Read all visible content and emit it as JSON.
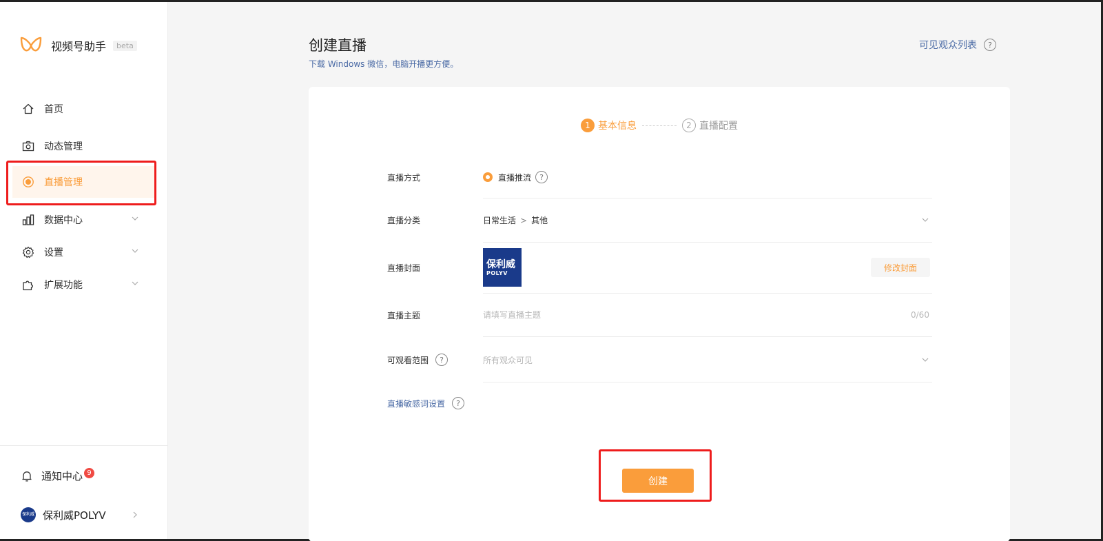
{
  "app": {
    "name": "视频号助手",
    "badge": "beta"
  },
  "sidebar": {
    "items": [
      {
        "label": "首页",
        "icon": "home-icon"
      },
      {
        "label": "动态管理",
        "icon": "camera-icon"
      },
      {
        "label": "直播管理",
        "icon": "live-icon",
        "active": true
      },
      {
        "label": "数据中心",
        "icon": "bar-chart-icon",
        "expandable": true
      },
      {
        "label": "设置",
        "icon": "gear-icon",
        "expandable": true
      },
      {
        "label": "扩展功能",
        "icon": "puzzle-icon",
        "expandable": true
      }
    ],
    "notification": {
      "label": "通知中心",
      "count": "9"
    },
    "account": {
      "name": "保利威POLYV",
      "avatar_text": "保利威"
    }
  },
  "header": {
    "title": "创建直播",
    "subtitle": "下载 Windows 微信，电脑开播更方便。",
    "audience_link": "可见观众列表",
    "help_mark": "?"
  },
  "steps": [
    {
      "num": "1",
      "label": "基本信息",
      "active": true
    },
    {
      "num": "2",
      "label": "直播配置",
      "active": false
    }
  ],
  "form": {
    "method": {
      "label": "直播方式",
      "option": "直播推流"
    },
    "category": {
      "label": "直播分类",
      "primary": "日常生活",
      "separator": ">",
      "secondary": "其他"
    },
    "cover": {
      "label": "直播封面",
      "thumb_title": "保利威",
      "thumb_sub": "POLYV",
      "edit_label": "修改封面"
    },
    "topic": {
      "label": "直播主题",
      "placeholder": "请填写直播主题",
      "counter": "0/60"
    },
    "visibility": {
      "label": "可观看范围",
      "value": "所有观众可见"
    },
    "sensitive": {
      "label": "直播敏感词设置"
    }
  },
  "actions": {
    "create_label": "创建"
  },
  "colors": {
    "accent": "#fa9d3b",
    "link": "#4a6aa5",
    "highlight": "#ee1c1c"
  }
}
